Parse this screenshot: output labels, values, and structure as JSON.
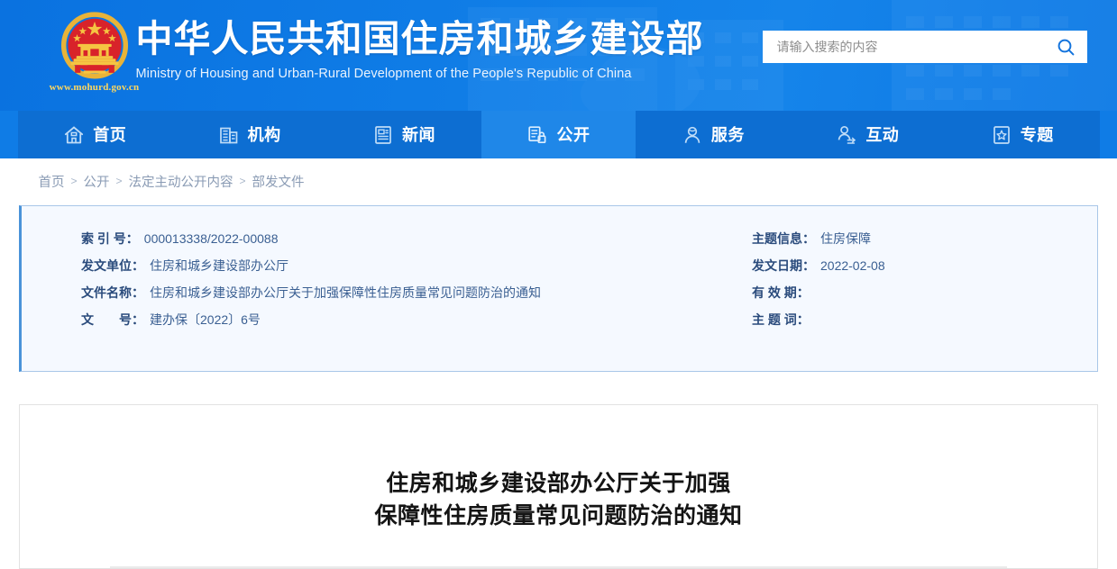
{
  "site": {
    "cn_title": "中华人民共和国住房和城乡建设部",
    "en_title": "Ministry of Housing and Urban-Rural Development of the People's Republic of China",
    "url": "www.mohurd.gov.cn",
    "emblem_icon": "national-emblem-icon"
  },
  "search": {
    "placeholder": "请输入搜索的内容",
    "value": "",
    "icon": "search-icon"
  },
  "nav": {
    "items": [
      {
        "label": "首页",
        "icon": "home-icon",
        "active": false
      },
      {
        "label": "机构",
        "icon": "building-icon",
        "active": false
      },
      {
        "label": "新闻",
        "icon": "newspaper-icon",
        "active": false
      },
      {
        "label": "公开",
        "icon": "open-document-icon",
        "active": true
      },
      {
        "label": "服务",
        "icon": "user-service-icon",
        "active": false
      },
      {
        "label": "互动",
        "icon": "user-exchange-icon",
        "active": false
      },
      {
        "label": "专题",
        "icon": "star-box-icon",
        "active": false
      }
    ]
  },
  "breadcrumb": {
    "items": [
      "首页",
      "公开",
      "法定主动公开内容",
      "部发文件"
    ],
    "separator": ">"
  },
  "meta": {
    "left": [
      {
        "label": "索 引 号：",
        "value": "000013338/2022-00088"
      },
      {
        "label": "发文单位：",
        "value": "住房和城乡建设部办公厅"
      },
      {
        "label": "文件名称：",
        "value": "住房和城乡建设部办公厅关于加强保障性住房质量常见问题防治的通知"
      },
      {
        "label": "文　　号：",
        "value": "建办保〔2022〕6号"
      }
    ],
    "right": [
      {
        "label": "主题信息：",
        "value": "住房保障"
      },
      {
        "label": "发文日期：",
        "value": "2022-02-08"
      },
      {
        "label": "有 效 期：",
        "value": ""
      },
      {
        "label": "主 题 词：",
        "value": ""
      }
    ]
  },
  "document": {
    "title_line1": "住房和城乡建设部办公厅关于加强",
    "title_line2": "保障性住房质量常见问题防治的通知"
  },
  "colors": {
    "header_blue": "#0f7ce6",
    "nav_blue": "#0d6ed2",
    "nav_active_blue": "#1f87e8",
    "accent_border": "#4a93d9",
    "card_bg": "#f5f9ff",
    "emblem_gold": "#e8b339",
    "emblem_red": "#d8232a",
    "url_yellow": "#ffd75e"
  }
}
